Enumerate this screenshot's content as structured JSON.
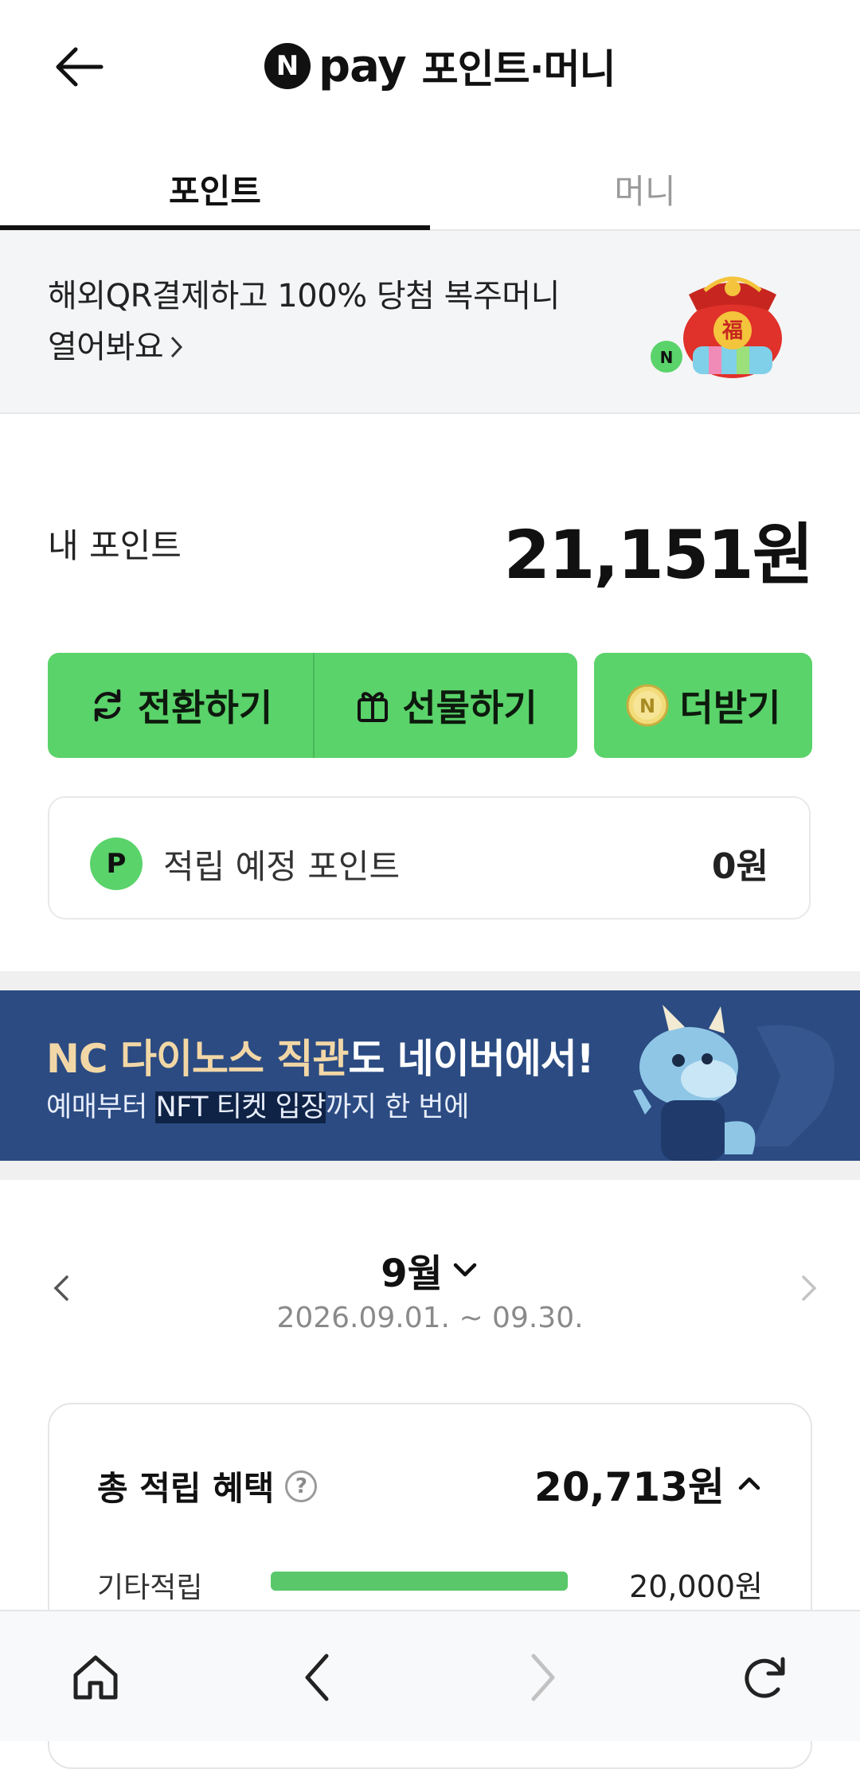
{
  "header": {
    "logo_letter": "N",
    "logo_word": "pay",
    "title": "포인트·머니"
  },
  "tabs": [
    {
      "label": "포인트",
      "active": true
    },
    {
      "label": "머니",
      "active": false
    }
  ],
  "promo": {
    "line1": "해외QR결제하고 100% 당첨 복주머니",
    "line2": "열어봐요",
    "pouch_char": "福"
  },
  "points": {
    "label": "내 포인트",
    "value": "21,151원"
  },
  "actions": {
    "convert": "전환하기",
    "gift": "선물하기",
    "more": "더받기"
  },
  "pending": {
    "badge": "P",
    "label": "적립 예정 포인트",
    "value": "0원"
  },
  "banner": {
    "title_highlight": "NC 다이노스 직관",
    "title_rest": "도 네이버에서!",
    "sub_pre": "예매부터 ",
    "sub_mark": "NFT 티켓 입장",
    "sub_post": "까지 한 번에"
  },
  "month": {
    "label": "9월",
    "range": "2026.09.01. ~ 09.30."
  },
  "summary": {
    "total_label": "총 적립 혜택",
    "help": "?",
    "total_value": "20,713원",
    "rows": [
      {
        "label": "기타적립",
        "value": "20,000원",
        "fraction": 1.0
      }
    ]
  },
  "colors": {
    "green": "#5ad36a",
    "banner_bg": "#2b4b82",
    "banner_highlight": "#f2d7a6"
  }
}
